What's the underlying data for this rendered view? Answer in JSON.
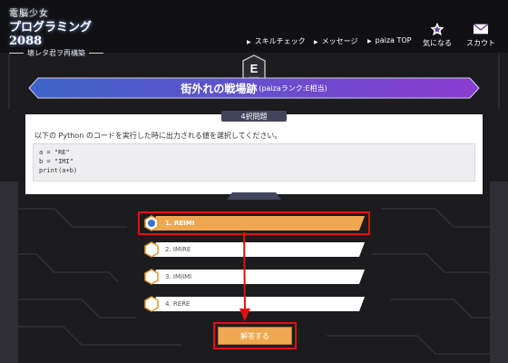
{
  "logo": {
    "line1": "電脳少女",
    "line2": "プログラミング2088",
    "line3": "壊レタ君ヲ再構築"
  },
  "nav": {
    "items": [
      {
        "label": "スキルチェック"
      },
      {
        "label": "メッセージ"
      },
      {
        "label": "paiza TOP"
      }
    ],
    "favorites_label": "気になる",
    "scout_label": "スカウト"
  },
  "stage": {
    "badge_letter": "E",
    "badge_text": "RANK",
    "title": "街外れの戦場跡",
    "rank": "(paizaランク:E相当)"
  },
  "question": {
    "tab_label": "4択問題",
    "text": "以下の Python のコードを実行した時に出力される値を選択してください。",
    "code_lines": [
      "a = \"RE\"",
      "b = \"IMI\"",
      "print(a+b)"
    ]
  },
  "options": [
    {
      "label": "1. REIMI",
      "selected": true
    },
    {
      "label": "2. IMIRE",
      "selected": false
    },
    {
      "label": "3. IMIIMI",
      "selected": false
    },
    {
      "label": "4. RERE",
      "selected": false
    }
  ],
  "answer_button": "解答する",
  "colors": {
    "accent": "#f0a850",
    "ribbon_start": "#3d64c8",
    "ribbon_end": "#8b3bd0",
    "highlight": "#e01010",
    "tab": "#42455c"
  }
}
